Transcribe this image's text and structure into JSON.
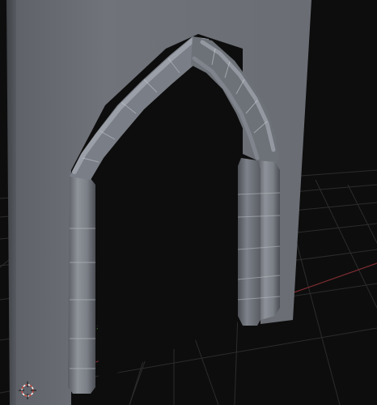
{
  "viewport": {
    "description_free": true,
    "colors": {
      "background": "#0d0d0d",
      "grid_line": "#2e2e2e",
      "axis_x": "#8a2f35",
      "axis_y": "#4f7f33",
      "wall_front": "#6e7178",
      "wall_side": "#585b61",
      "arch_light": "#8f939b",
      "arch_mid": "#6f737a",
      "arch_dark": "#4b4e54",
      "edge_white": "#dcdcdc",
      "cursor_red": "#d9443a"
    },
    "icons": [
      "3d-cursor-icon"
    ]
  }
}
